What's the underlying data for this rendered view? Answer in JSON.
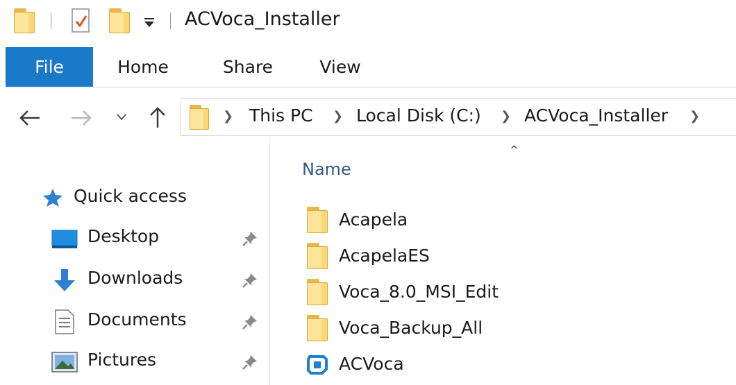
{
  "window": {
    "title": "ACVoca_Installer"
  },
  "ribbon": {
    "tabs": [
      {
        "label": "File",
        "active": true
      },
      {
        "label": "Home"
      },
      {
        "label": "Share"
      },
      {
        "label": "View"
      }
    ]
  },
  "address": {
    "crumbs": [
      "This PC",
      "Local Disk (C:)",
      "ACVoca_Installer"
    ]
  },
  "sidebar": {
    "quick_access_label": "Quick access",
    "items": [
      {
        "label": "Desktop",
        "icon": "desktop-icon"
      },
      {
        "label": "Downloads",
        "icon": "downloads-icon"
      },
      {
        "label": "Documents",
        "icon": "documents-icon"
      },
      {
        "label": "Pictures",
        "icon": "pictures-icon"
      }
    ]
  },
  "files": {
    "column_header": "Name",
    "items": [
      {
        "name": "Acapela",
        "type": "folder"
      },
      {
        "name": "AcapelaES",
        "type": "folder"
      },
      {
        "name": "Voca_8.0_MSI_Edit",
        "type": "folder"
      },
      {
        "name": "Voca_Backup_All",
        "type": "folder"
      },
      {
        "name": "ACVoca",
        "type": "application"
      }
    ]
  },
  "colors": {
    "accent": "#1979ca",
    "folder": "#f8d775"
  }
}
